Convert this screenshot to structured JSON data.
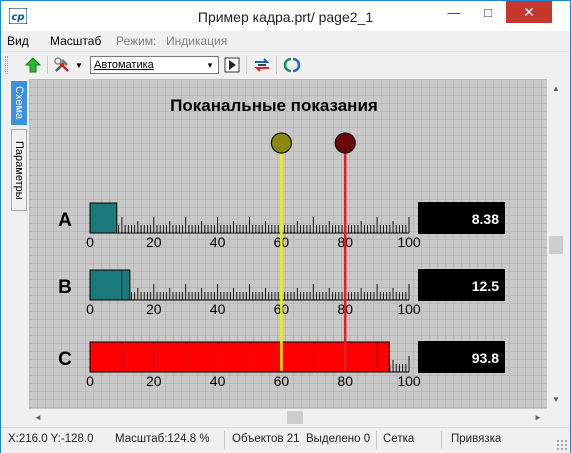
{
  "window": {
    "title": "Пример кадра.prt/ page2_1"
  },
  "window_buttons": {
    "minimize": "—",
    "maximize": "□",
    "close": "✕"
  },
  "menubar": {
    "items": [
      "Вид",
      "Масштаб"
    ],
    "mode_label": "Режим:",
    "mode_value": "Индикация"
  },
  "toolbar": {
    "mode_select": "Автоматика",
    "select_arrow": "▼",
    "dropdown_arrow": "▾"
  },
  "side_tabs": {
    "schema": "Схема",
    "params": "Параметры"
  },
  "scroll": {
    "up": "▲",
    "down": "▼",
    "left": "◄",
    "right": "►"
  },
  "display": {
    "title": "Поканальные показания",
    "scale_ticks": [
      "0",
      "20",
      "40",
      "60",
      "80",
      "100"
    ],
    "markers": [
      {
        "name": "yellow",
        "value": 60,
        "color": "#f0f000",
        "knob": "#8a8a10"
      },
      {
        "name": "red",
        "value": 80,
        "color": "#e02020",
        "knob": "#6a0808"
      }
    ],
    "channels": [
      {
        "label": "A",
        "value_text": "8.38",
        "value": 8.38,
        "color": "#1a7a7a"
      },
      {
        "label": "B",
        "value_text": "12.5",
        "value": 12.5,
        "color": "#1a7a7a"
      },
      {
        "label": "C",
        "value_text": "93.8",
        "value": 93.8,
        "color": "#ff0000"
      }
    ]
  },
  "status": {
    "coords": "X:216.0  Y:-128.0",
    "zoom": "Масштаб:124.8 %",
    "objects": "Объектов 21",
    "selected": "Выделено 0",
    "grid": "Сетка",
    "snap": "Привязка"
  }
}
